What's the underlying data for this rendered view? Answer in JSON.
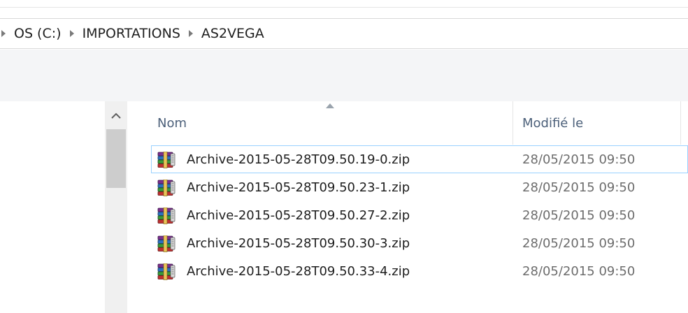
{
  "breadcrumb": {
    "items": [
      "OS (C:)",
      "IMPORTATIONS",
      "AS2VEGA"
    ]
  },
  "columns": {
    "name": "Nom",
    "modified": "Modifié le"
  },
  "files": [
    {
      "name": "Archive-2015-05-28T09.50.19-0.zip",
      "modified": "28/05/2015 09:50",
      "selected": true
    },
    {
      "name": "Archive-2015-05-28T09.50.23-1.zip",
      "modified": "28/05/2015 09:50",
      "selected": false
    },
    {
      "name": "Archive-2015-05-28T09.50.27-2.zip",
      "modified": "28/05/2015 09:50",
      "selected": false
    },
    {
      "name": "Archive-2015-05-28T09.50.30-3.zip",
      "modified": "28/05/2015 09:50",
      "selected": false
    },
    {
      "name": "Archive-2015-05-28T09.50.33-4.zip",
      "modified": "28/05/2015 09:50",
      "selected": false
    }
  ],
  "icons": {
    "file": "winrar-archive-icon",
    "breadcrumb_separator": "chevron-right-icon",
    "sort": "sort-ascending-icon",
    "scroll_up": "chevron-up-icon"
  },
  "colors": {
    "header_text": "#4c607a",
    "selection_border": "#99d1ff",
    "date_text": "#6d6d6d"
  }
}
